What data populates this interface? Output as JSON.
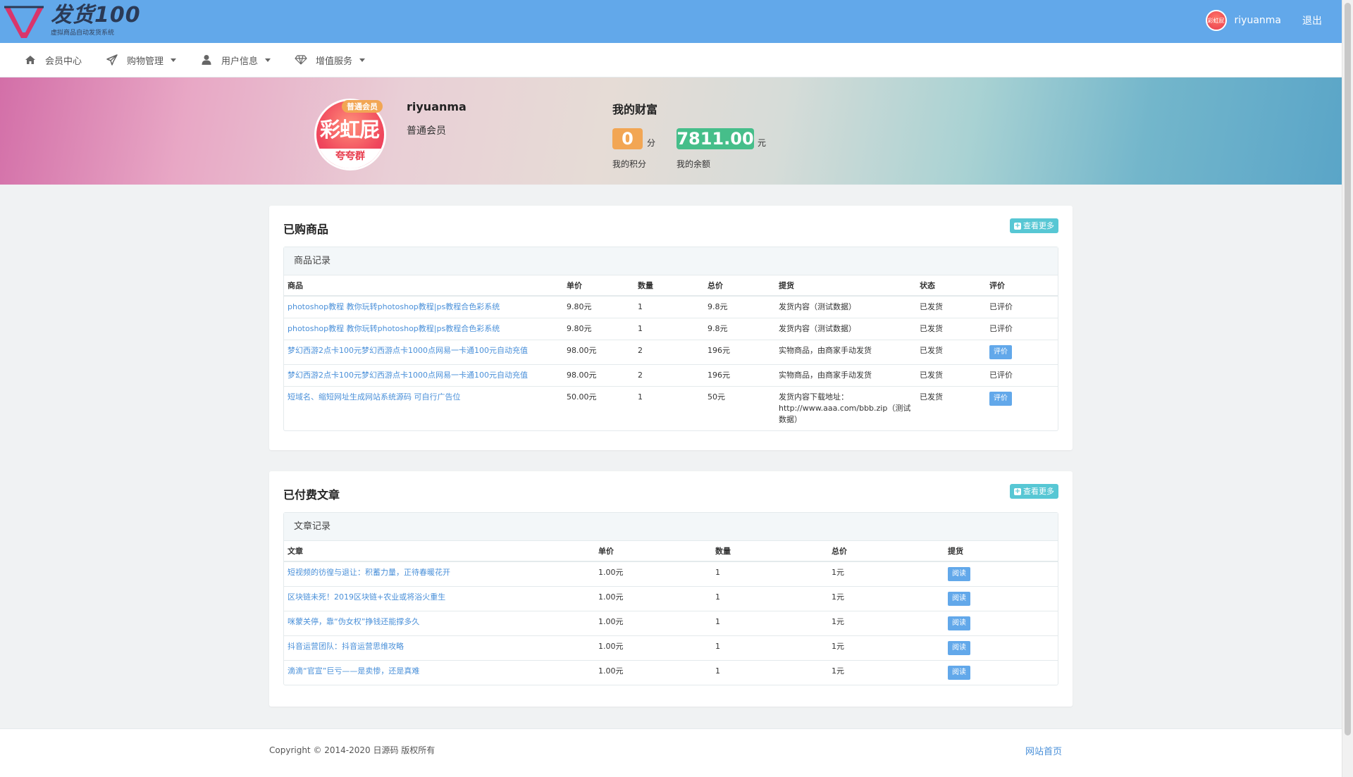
{
  "brand": {
    "title": "发货100",
    "subtitle": "虚拟商品自动发货系统"
  },
  "topbar": {
    "avatar_text": "彩虹屁",
    "username": "riyuanma",
    "logout": "退出"
  },
  "nav": {
    "items": [
      {
        "label": "会员中心",
        "icon": "home-icon",
        "dropdown": false
      },
      {
        "label": "购物管理",
        "icon": "paper-plane-icon",
        "dropdown": true
      },
      {
        "label": "用户信息",
        "icon": "user-icon",
        "dropdown": true
      },
      {
        "label": "增值服务",
        "icon": "diamond-icon",
        "dropdown": true
      }
    ]
  },
  "profile": {
    "avatar_main": "彩虹屁",
    "avatar_sub": "夸夸群",
    "badge": "普通会员",
    "username": "riyuanma",
    "level": "普通会员",
    "wealth_title": "我的财富",
    "points": "0",
    "points_unit": "分",
    "points_label": "我的积分",
    "balance": "7811.00",
    "balance_unit": "元",
    "balance_label": "我的余额"
  },
  "purchases": {
    "title": "已购商品",
    "more": "查看更多",
    "subtitle": "商品记录",
    "columns": [
      "商品",
      "单价",
      "数量",
      "总价",
      "提货",
      "状态",
      "评价"
    ],
    "rows": [
      {
        "name": "photoshop教程 教你玩转photoshop教程|ps教程合色彩系统",
        "price": "9.80元",
        "qty": "1",
        "total": "9.8元",
        "delivery": "发货内容（测试数据）",
        "status": "已发货",
        "review": "已评价",
        "review_button": false
      },
      {
        "name": "photoshop教程 教你玩转photoshop教程|ps教程合色彩系统",
        "price": "9.80元",
        "qty": "1",
        "total": "9.8元",
        "delivery": "发货内容（测试数据）",
        "status": "已发货",
        "review": "已评价",
        "review_button": false
      },
      {
        "name": "梦幻西游2点卡100元梦幻西游点卡1000点网易一卡通100元自动充值",
        "price": "98.00元",
        "qty": "2",
        "total": "196元",
        "delivery": "实物商品，由商家手动发货",
        "status": "已发货",
        "review": "评价",
        "review_button": true
      },
      {
        "name": "梦幻西游2点卡100元梦幻西游点卡1000点网易一卡通100元自动充值",
        "price": "98.00元",
        "qty": "2",
        "total": "196元",
        "delivery": "实物商品，由商家手动发货",
        "status": "已发货",
        "review": "已评价",
        "review_button": false
      },
      {
        "name": "短域名、缩短网址生成网站系统源码 可自行广告位",
        "price": "50.00元",
        "qty": "1",
        "total": "50元",
        "delivery": "发货内容下载地址：http://www.aaa.com/bbb.zip（测试数据）",
        "status": "已发货",
        "review": "评价",
        "review_button": true
      }
    ]
  },
  "articles": {
    "title": "已付费文章",
    "more": "查看更多",
    "subtitle": "文章记录",
    "columns": [
      "文章",
      "单价",
      "数量",
      "总价",
      "提货"
    ],
    "rows": [
      {
        "name": "短视频的彷徨与退让：积蓄力量，正待春暖花开",
        "price": "1.00元",
        "qty": "1",
        "total": "1元",
        "action": "阅读"
      },
      {
        "name": "区块链未死！2019区块链+农业或将浴火重生",
        "price": "1.00元",
        "qty": "1",
        "total": "1元",
        "action": "阅读"
      },
      {
        "name": "咪蒙关停，靠“伪女权”挣钱还能撑多久",
        "price": "1.00元",
        "qty": "1",
        "total": "1元",
        "action": "阅读"
      },
      {
        "name": "抖音运营团队：抖音运营思维攻略",
        "price": "1.00元",
        "qty": "1",
        "total": "1元",
        "action": "阅读"
      },
      {
        "name": "滴滴“官宣”巨亏——是卖惨，还是真难",
        "price": "1.00元",
        "qty": "1",
        "total": "1元",
        "action": "阅读"
      }
    ]
  },
  "footer": {
    "copyright": "Copyright © 2014-2020 日源码 版权所有",
    "home_link": "网站首页"
  },
  "colors": {
    "topbar": "#62a8ea",
    "link": "#4a90d9",
    "points_pill": "#f2a654",
    "balance_pill": "#46be8a",
    "more_button": "#57c7d4"
  }
}
